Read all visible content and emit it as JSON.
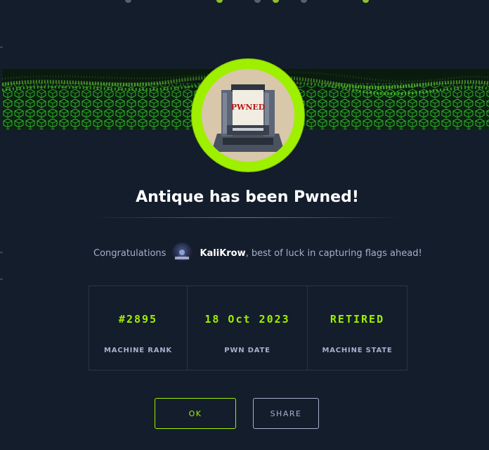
{
  "modal": {
    "title": "Antique has been Pwned!",
    "avatar_label": "PWNED",
    "congrats_prefix": "Congratulations",
    "username": "KaliKrow",
    "congrats_suffix": ", best of luck in capturing flags ahead!",
    "stats": [
      {
        "value": "#2895",
        "label": "MACHINE RANK"
      },
      {
        "value": "18 Oct 2023",
        "label": "PWN DATE"
      },
      {
        "value": "RETIRED",
        "label": "MACHINE STATE"
      }
    ],
    "ok_label": "OK",
    "share_label": "SHARE"
  },
  "colors": {
    "accent": "#9fef00",
    "background": "#141d2b",
    "muted_text": "#a4b1cd",
    "border": "#2a3447"
  },
  "icons": [
    "printer-pwned-icon",
    "user-avatar-icon",
    "cube-grid-banner"
  ]
}
